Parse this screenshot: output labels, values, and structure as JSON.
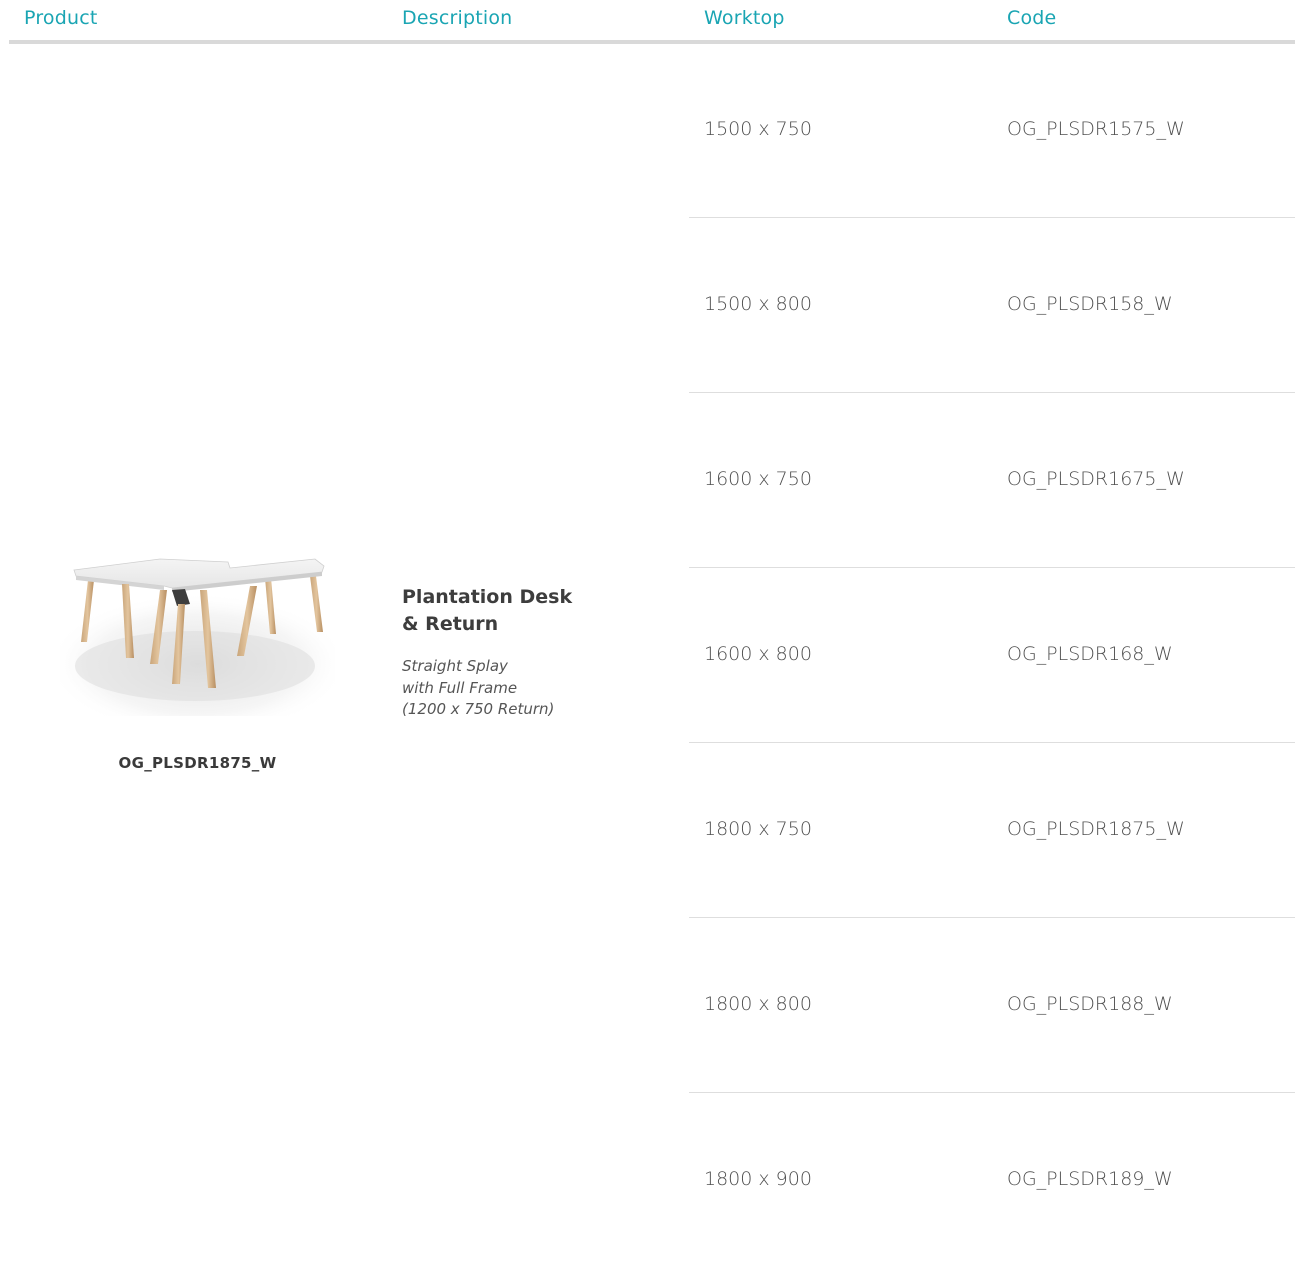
{
  "header": {
    "product": "Product",
    "description": "Description",
    "worktop": "Worktop",
    "code": "Code"
  },
  "product": {
    "code": "OG_PLSDR1875_W",
    "image_icon": "l-shaped-desk-image"
  },
  "description": {
    "title": "Plantation Desk\n& Return",
    "subtitle": "Straight Splay\nwith Full Frame\n(1200 x 750 Return)"
  },
  "rows": [
    {
      "worktop": "1500 x 750",
      "code": "OG_PLSDR1575_W"
    },
    {
      "worktop": "1500 x 800",
      "code": "OG_PLSDR158_W"
    },
    {
      "worktop": "1600 x 750",
      "code": "OG_PLSDR1675_W"
    },
    {
      "worktop": "1600 x 800",
      "code": "OG_PLSDR168_W"
    },
    {
      "worktop": "1800 x 750",
      "code": "OG_PLSDR1875_W"
    },
    {
      "worktop": "1800 x 800",
      "code": "OG_PLSDR188_W"
    },
    {
      "worktop": "1800 x 900",
      "code": "OG_PLSDR189_W"
    }
  ],
  "colors": {
    "header_text": "#1aa5b3",
    "header_rule": "#d9d9d9",
    "row_divider": "#dedede"
  }
}
